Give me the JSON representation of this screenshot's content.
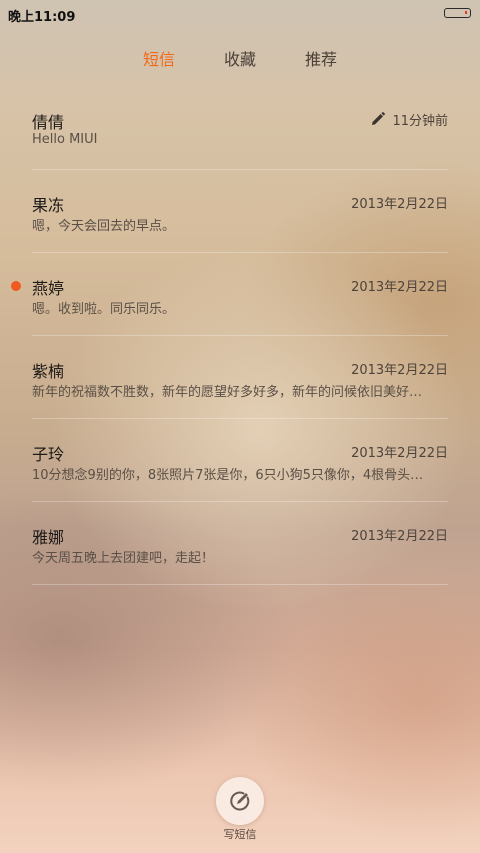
{
  "status_bar": {
    "time": "晚上11:09"
  },
  "tabs": [
    {
      "label": "短信",
      "active": true
    },
    {
      "label": "收藏",
      "active": false
    },
    {
      "label": "推荐",
      "active": false
    }
  ],
  "messages": [
    {
      "name": "倩倩",
      "preview": "Hello MIUI",
      "date": "11分钟前",
      "draft": true,
      "unread": false
    },
    {
      "name": "果冻",
      "preview": "嗯，今天会回去的早点。",
      "date": "2013年2月22日",
      "draft": false,
      "unread": false
    },
    {
      "name": "燕婷",
      "preview": "嗯。收到啦。同乐同乐。",
      "date": "2013年2月22日",
      "draft": false,
      "unread": true
    },
    {
      "name": "紫楠",
      "preview": "新年的祝福数不胜数，新年的愿望好多好多，新年的问候依旧美好…",
      "date": "2013年2月22日",
      "draft": false,
      "unread": false
    },
    {
      "name": "子玲",
      "preview": "10分想念9别的你，8张照片7张是你，6只小狗5只像你，4根骨头…",
      "date": "2013年2月22日",
      "draft": false,
      "unread": false
    },
    {
      "name": "雅娜",
      "preview": "今天周五晚上去团建吧，走起！",
      "date": "2013年2月22日",
      "draft": false,
      "unread": false
    }
  ],
  "compose": {
    "label": "写短信",
    "icon": "compose-icon"
  },
  "colors": {
    "accent": "#f06a1a",
    "unread_dot": "#f05a1e"
  }
}
